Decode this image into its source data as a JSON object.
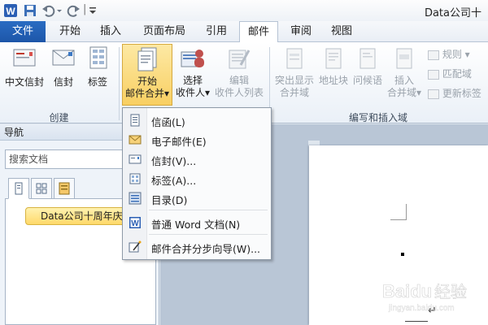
{
  "titlebar": {
    "doc_title": "Data公司十",
    "qa_separator": "|",
    "quick_access": [
      "word-app-icon",
      "save-icon",
      "undo-icon",
      "redo-icon",
      "customize-icon"
    ]
  },
  "tabs": {
    "file": "文件",
    "home": "开始",
    "insert": "插入",
    "layout": "页面布局",
    "references": "引用",
    "mailings": "邮件",
    "review": "审阅",
    "view": "视图"
  },
  "ribbon": {
    "create": {
      "label": "创建",
      "chinese_envelope": "中文信封",
      "envelopes": "信封",
      "labels": "标签"
    },
    "start_merge": {
      "line1": "开始",
      "line2": "邮件合并",
      "arrow": "▾"
    },
    "select_recipients": {
      "line1": "选择",
      "line2": "收件人",
      "arrow": "▾"
    },
    "edit_recipients": {
      "line1": "编辑",
      "line2": "收件人列表"
    },
    "write_insert": {
      "label": "编写和插入域",
      "highlight": [
        "突出显示",
        "合并域"
      ],
      "address_block": "地址块",
      "greeting": "问候语",
      "insert_field": [
        "插入",
        "合并域"
      ],
      "field_arrow": "▾",
      "rules": "规则",
      "rules_arrow": "▾",
      "match_fields": "匹配域",
      "update_labels": "更新标签"
    }
  },
  "menu": {
    "items": [
      {
        "label": "信函(L)",
        "icon": "letter-icon"
      },
      {
        "label": "电子邮件(E)",
        "icon": "email-icon"
      },
      {
        "label": "信封(V)...",
        "icon": "envelope-icon"
      },
      {
        "label": "标签(A)...",
        "icon": "label-icon"
      },
      {
        "label": "目录(D)",
        "icon": "directory-icon"
      },
      {
        "label": "普通 Word 文档(N)",
        "icon": "word-doc-icon"
      },
      {
        "label": "邮件合并分步向导(W)...",
        "icon": "wizard-icon"
      }
    ]
  },
  "nav": {
    "title": "导航",
    "search_placeholder": "搜索文档",
    "heading": "Data公司十周年庆典"
  },
  "document": {
    "paragraph_mark": "↵"
  },
  "watermark": {
    "text": "Baidu经验",
    "url": "jingyan.baidu.com"
  },
  "colors": {
    "file_tab": "#2a6cc3",
    "active_button": "#f8cf62",
    "nav_heading": "#ffd96a"
  }
}
